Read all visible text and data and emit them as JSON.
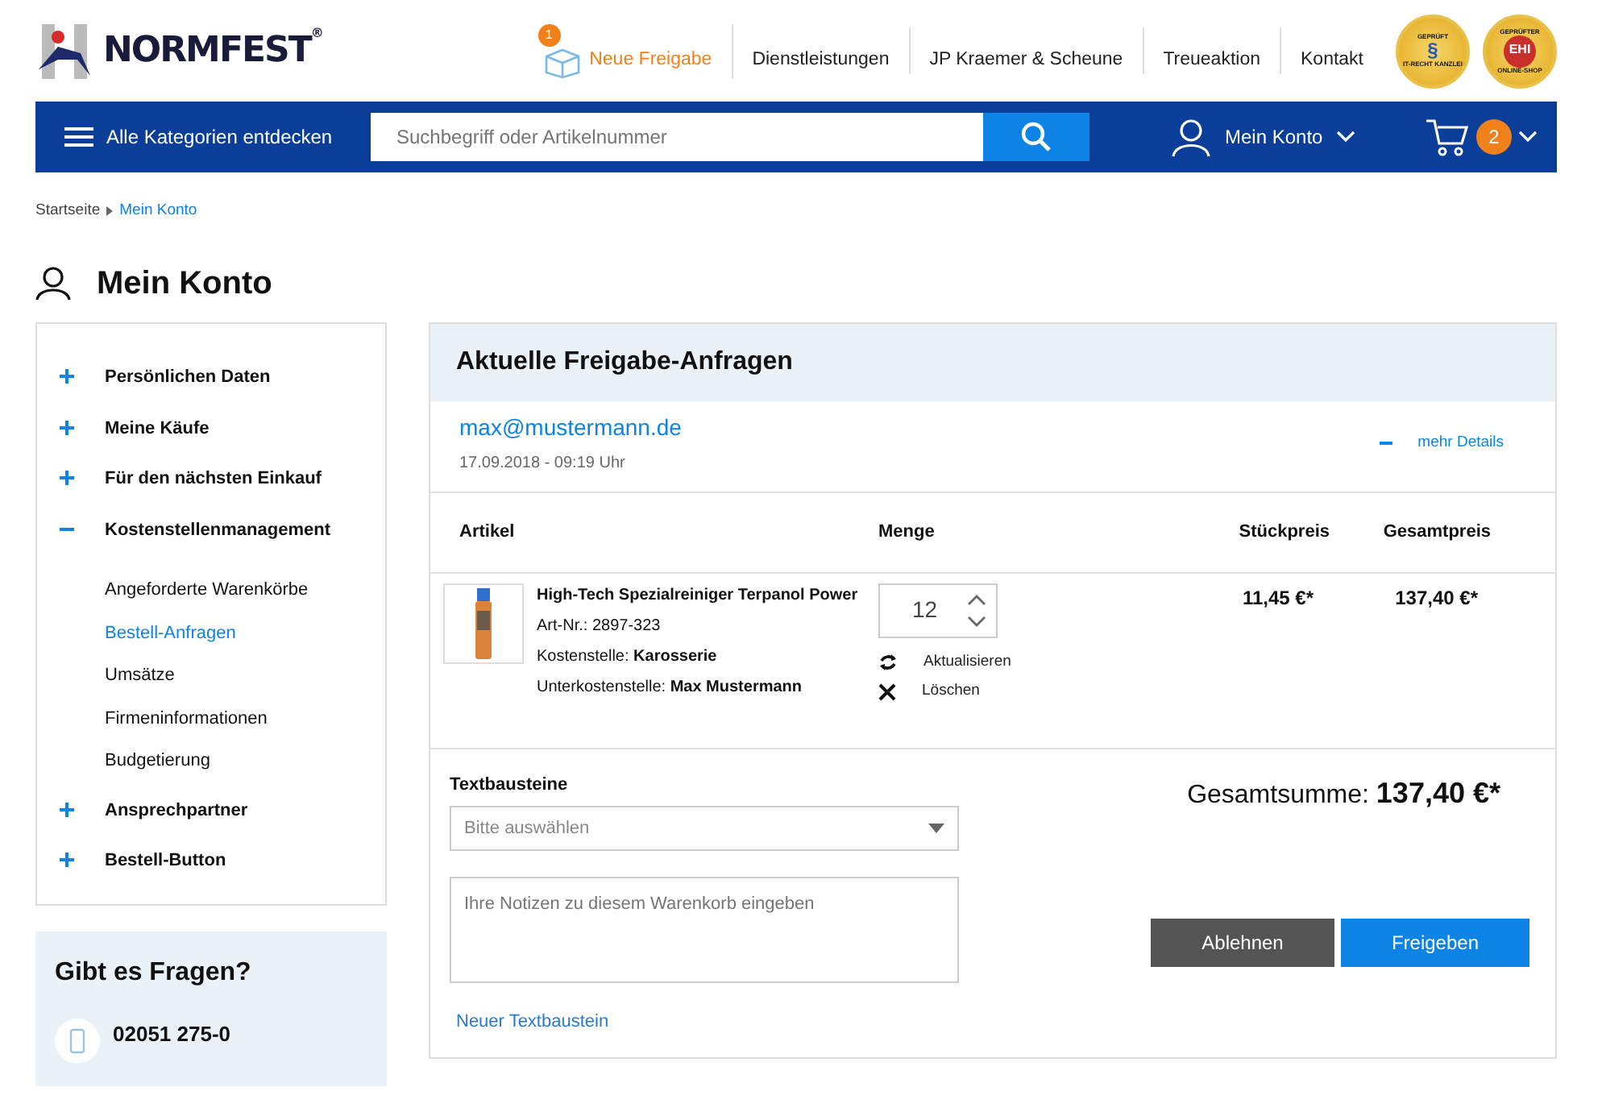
{
  "logo": {
    "text": "NORMFEST",
    "mark": "®"
  },
  "top_nav": [
    {
      "label": "Neue Freigabe",
      "badge": "1",
      "selected": true
    },
    {
      "label": "Dienstleistungen",
      "selected": false
    },
    {
      "label": "JP Kraemer & Scheune",
      "selected": false
    },
    {
      "label": "Treueaktion",
      "selected": false
    },
    {
      "label": "Kontakt",
      "selected": false
    }
  ],
  "seals": [
    {
      "top": "GEPRÜFT",
      "center": "§",
      "bottom": "IT-RECHT KANZLEI"
    },
    {
      "top": "GEPRÜFTER",
      "center": "EHI",
      "bottom": "ONLINE-SHOP"
    }
  ],
  "main_bar": {
    "categories": "Alle Kategorien entdecken",
    "search": {
      "placeholder": "Suchbegriff oder Artikelnummer"
    },
    "account": "Mein Konto",
    "cart_count": "2"
  },
  "breadcrumb": [
    {
      "label": "Startseite",
      "selected": false
    },
    {
      "label": "Mein Konto",
      "selected": true
    }
  ],
  "page_title": "Mein Konto",
  "sidebar": {
    "items": [
      {
        "label": "Persönlichen Daten",
        "expanded": false
      },
      {
        "label": "Meine Käufe",
        "expanded": false
      },
      {
        "label": "Für den nächsten Einkauf",
        "expanded": false
      },
      {
        "label": "Kostenstellenmanagement",
        "expanded": true,
        "children": [
          {
            "label": "Angeforderte Warenkörbe",
            "selected": false
          },
          {
            "label": "Bestell-Anfragen",
            "selected": true
          },
          {
            "label": "Umsätze",
            "selected": false
          },
          {
            "label": "Firmeninformationen",
            "selected": false
          },
          {
            "label": "Budgetierung",
            "selected": false
          }
        ]
      },
      {
        "label": "Ansprechpartner",
        "expanded": false
      },
      {
        "label": "Bestell-Button",
        "expanded": false
      }
    ]
  },
  "help": {
    "title": "Gibt es Fragen?",
    "phone": "02051 275-0"
  },
  "panel": {
    "title": "Aktuelle Freigabe-Anfragen",
    "email": "max@mustermann.de",
    "date": "17.09.2018 - 09:19 Uhr",
    "details": {
      "label": "mehr Details",
      "expanded": true
    },
    "columns": [
      "Artikel",
      "Menge",
      "Stückpreis",
      "Gesamtpreis"
    ],
    "rows": [
      {
        "name": "High-Tech Spezialreiniger Terpanol Power",
        "article_no": "Art-Nr.: 2897-323",
        "cost_center": "Kostenstelle: **Karosserie**",
        "sub_cost_center": "Unterkostenstelle: **Max Mustermann**",
        "quantity": "12",
        "update": "Aktualisieren",
        "delete": "Löschen",
        "unit_price": "11,45 €*",
        "total": "137,40 €*"
      }
    ],
    "snippets_label": "Textbausteine",
    "snippets_select": {
      "placeholder": "Bitte auswählen"
    },
    "notes": {
      "placeholder": "Ihre Notizen zu diesem Warenkorb eingeben"
    },
    "new_snippet": "Neuer Textbaustein",
    "sum_label": "Gesamtsumme:",
    "sum_value": "137,40 €*",
    "reject": "Ablehnen",
    "approve": "Freigeben"
  }
}
